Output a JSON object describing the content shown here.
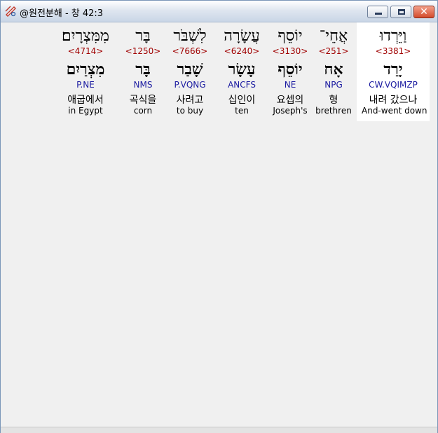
{
  "window": {
    "title": "@원전분해 - 창 42:3",
    "close_glyph": "✕"
  },
  "words": [
    {
      "hebrew": "וַיֵּרְדוּ",
      "strong": "<3381>",
      "root": "יָרַד",
      "parse": "CW.VQIMZP",
      "korean": "내려 갔으나",
      "english": "And-went down",
      "highlighted": true
    },
    {
      "hebrew": "אֲחֵי־",
      "strong": "<251>",
      "root": "אָח",
      "parse": "NPG",
      "korean": "형",
      "english": "brethren"
    },
    {
      "hebrew": "יוֹסֵף",
      "strong": "<3130>",
      "root": "יוֹסֵף",
      "parse": "NE",
      "korean": "요셉의",
      "english": "Joseph's"
    },
    {
      "hebrew": "עֲשָׂרָה",
      "strong": "<6240>",
      "root": "עָשָׂר",
      "parse": "ANCFS",
      "korean": "십인이",
      "english": "ten"
    },
    {
      "hebrew": "לִשְׁבֹּר",
      "strong": "<7666>",
      "root": "שָׁבַר",
      "parse": "P.VQNG",
      "korean": "사려고",
      "english": "to buy"
    },
    {
      "hebrew": "בָּר",
      "strong": "<1250>",
      "root": "בָּר",
      "parse": "NMS",
      "korean": "곡식을",
      "english": "corn"
    },
    {
      "hebrew": "מִמִּצְרָיִם׃",
      "strong": "<4714>",
      "root": "מִצְרַיִם",
      "parse": "P.NE",
      "korean": "애굽에서",
      "english": "in Egypt"
    }
  ]
}
